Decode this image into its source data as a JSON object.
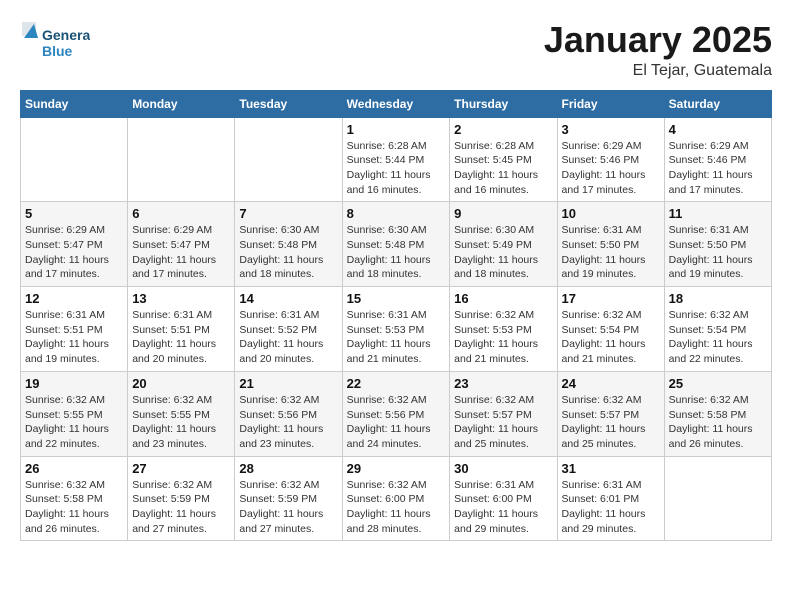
{
  "logo": {
    "general": "General",
    "blue": "Blue"
  },
  "title": "January 2025",
  "subtitle": "El Tejar, Guatemala",
  "days_of_week": [
    "Sunday",
    "Monday",
    "Tuesday",
    "Wednesday",
    "Thursday",
    "Friday",
    "Saturday"
  ],
  "weeks": [
    [
      {
        "day": "",
        "info": ""
      },
      {
        "day": "",
        "info": ""
      },
      {
        "day": "",
        "info": ""
      },
      {
        "day": "1",
        "info": "Sunrise: 6:28 AM\nSunset: 5:44 PM\nDaylight: 11 hours\nand 16 minutes."
      },
      {
        "day": "2",
        "info": "Sunrise: 6:28 AM\nSunset: 5:45 PM\nDaylight: 11 hours\nand 16 minutes."
      },
      {
        "day": "3",
        "info": "Sunrise: 6:29 AM\nSunset: 5:46 PM\nDaylight: 11 hours\nand 17 minutes."
      },
      {
        "day": "4",
        "info": "Sunrise: 6:29 AM\nSunset: 5:46 PM\nDaylight: 11 hours\nand 17 minutes."
      }
    ],
    [
      {
        "day": "5",
        "info": "Sunrise: 6:29 AM\nSunset: 5:47 PM\nDaylight: 11 hours\nand 17 minutes."
      },
      {
        "day": "6",
        "info": "Sunrise: 6:29 AM\nSunset: 5:47 PM\nDaylight: 11 hours\nand 17 minutes."
      },
      {
        "day": "7",
        "info": "Sunrise: 6:30 AM\nSunset: 5:48 PM\nDaylight: 11 hours\nand 18 minutes."
      },
      {
        "day": "8",
        "info": "Sunrise: 6:30 AM\nSunset: 5:48 PM\nDaylight: 11 hours\nand 18 minutes."
      },
      {
        "day": "9",
        "info": "Sunrise: 6:30 AM\nSunset: 5:49 PM\nDaylight: 11 hours\nand 18 minutes."
      },
      {
        "day": "10",
        "info": "Sunrise: 6:31 AM\nSunset: 5:50 PM\nDaylight: 11 hours\nand 19 minutes."
      },
      {
        "day": "11",
        "info": "Sunrise: 6:31 AM\nSunset: 5:50 PM\nDaylight: 11 hours\nand 19 minutes."
      }
    ],
    [
      {
        "day": "12",
        "info": "Sunrise: 6:31 AM\nSunset: 5:51 PM\nDaylight: 11 hours\nand 19 minutes."
      },
      {
        "day": "13",
        "info": "Sunrise: 6:31 AM\nSunset: 5:51 PM\nDaylight: 11 hours\nand 20 minutes."
      },
      {
        "day": "14",
        "info": "Sunrise: 6:31 AM\nSunset: 5:52 PM\nDaylight: 11 hours\nand 20 minutes."
      },
      {
        "day": "15",
        "info": "Sunrise: 6:31 AM\nSunset: 5:53 PM\nDaylight: 11 hours\nand 21 minutes."
      },
      {
        "day": "16",
        "info": "Sunrise: 6:32 AM\nSunset: 5:53 PM\nDaylight: 11 hours\nand 21 minutes."
      },
      {
        "day": "17",
        "info": "Sunrise: 6:32 AM\nSunset: 5:54 PM\nDaylight: 11 hours\nand 21 minutes."
      },
      {
        "day": "18",
        "info": "Sunrise: 6:32 AM\nSunset: 5:54 PM\nDaylight: 11 hours\nand 22 minutes."
      }
    ],
    [
      {
        "day": "19",
        "info": "Sunrise: 6:32 AM\nSunset: 5:55 PM\nDaylight: 11 hours\nand 22 minutes."
      },
      {
        "day": "20",
        "info": "Sunrise: 6:32 AM\nSunset: 5:55 PM\nDaylight: 11 hours\nand 23 minutes."
      },
      {
        "day": "21",
        "info": "Sunrise: 6:32 AM\nSunset: 5:56 PM\nDaylight: 11 hours\nand 23 minutes."
      },
      {
        "day": "22",
        "info": "Sunrise: 6:32 AM\nSunset: 5:56 PM\nDaylight: 11 hours\nand 24 minutes."
      },
      {
        "day": "23",
        "info": "Sunrise: 6:32 AM\nSunset: 5:57 PM\nDaylight: 11 hours\nand 25 minutes."
      },
      {
        "day": "24",
        "info": "Sunrise: 6:32 AM\nSunset: 5:57 PM\nDaylight: 11 hours\nand 25 minutes."
      },
      {
        "day": "25",
        "info": "Sunrise: 6:32 AM\nSunset: 5:58 PM\nDaylight: 11 hours\nand 26 minutes."
      }
    ],
    [
      {
        "day": "26",
        "info": "Sunrise: 6:32 AM\nSunset: 5:58 PM\nDaylight: 11 hours\nand 26 minutes."
      },
      {
        "day": "27",
        "info": "Sunrise: 6:32 AM\nSunset: 5:59 PM\nDaylight: 11 hours\nand 27 minutes."
      },
      {
        "day": "28",
        "info": "Sunrise: 6:32 AM\nSunset: 5:59 PM\nDaylight: 11 hours\nand 27 minutes."
      },
      {
        "day": "29",
        "info": "Sunrise: 6:32 AM\nSunset: 6:00 PM\nDaylight: 11 hours\nand 28 minutes."
      },
      {
        "day": "30",
        "info": "Sunrise: 6:31 AM\nSunset: 6:00 PM\nDaylight: 11 hours\nand 29 minutes."
      },
      {
        "day": "31",
        "info": "Sunrise: 6:31 AM\nSunset: 6:01 PM\nDaylight: 11 hours\nand 29 minutes."
      },
      {
        "day": "",
        "info": ""
      }
    ]
  ]
}
